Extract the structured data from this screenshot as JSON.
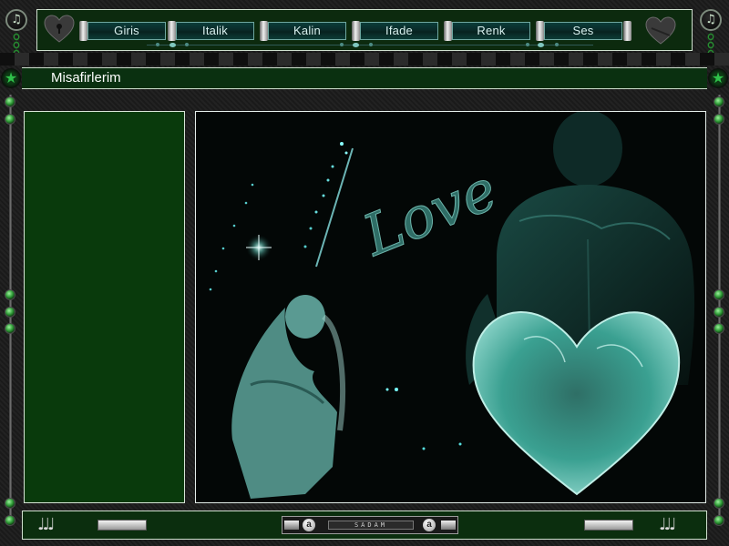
{
  "header": {
    "nav": [
      {
        "label": "Giris"
      },
      {
        "label": "Italik"
      },
      {
        "label": "Kalin"
      },
      {
        "label": "Ifade"
      },
      {
        "label": "Renk"
      },
      {
        "label": "Ses"
      }
    ],
    "left_icon": "music-note-icon",
    "right_icon": "music-note-icon"
  },
  "title_bar": {
    "title": "Misafirlerim",
    "icons": [
      "star-icon",
      "star-icon"
    ]
  },
  "main": {
    "image_text": "Love"
  },
  "footer": {
    "center_label": "SADAM",
    "badge_left": "a",
    "badge_right": "a"
  },
  "colors": {
    "panel_green": "#093a0c",
    "bar_green": "#0c2a0e",
    "accent_teal": "#4fb8ad"
  }
}
